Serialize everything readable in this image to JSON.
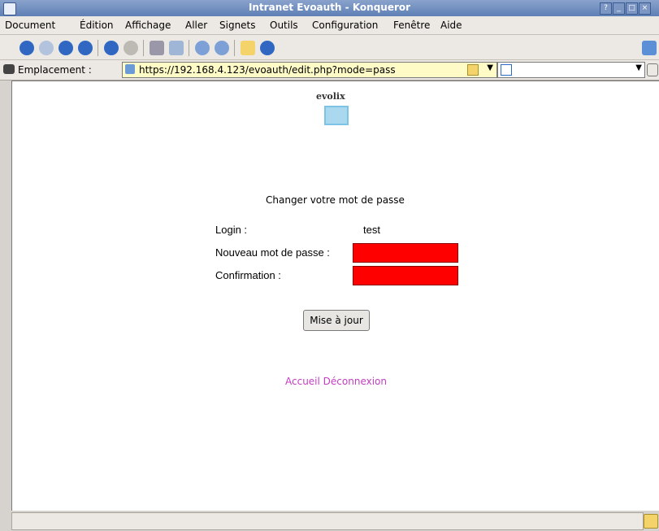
{
  "window": {
    "title": "Intranet Evoauth - Konqueror",
    "controls": [
      "?",
      "_",
      "□",
      "×"
    ]
  },
  "menu": [
    "Document",
    "Édition",
    "Affichage",
    "Aller",
    "Signets",
    "Outils",
    "Configuration",
    "Fenêtre",
    "Aide"
  ],
  "location": {
    "label": "Emplacement :",
    "url": "https://192.168.4.123/evoauth/edit.php?mode=pass"
  },
  "page": {
    "logo_text": "evolix",
    "heading": "Changer votre mot de passe",
    "login_label": "Login :",
    "login_value": "test",
    "new_pass_label": "Nouveau mot de passe :",
    "confirm_label": "Confirmation :",
    "submit": "Mise à jour",
    "links": "Accueil Déconnexion"
  }
}
